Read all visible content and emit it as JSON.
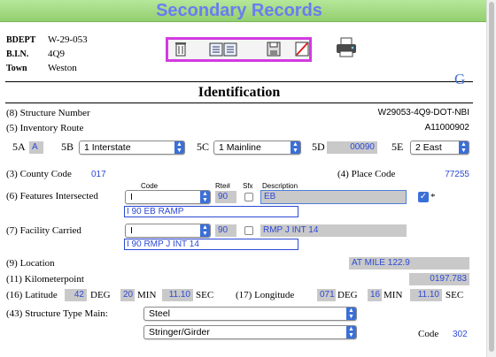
{
  "header": {
    "title": "Secondary Records"
  },
  "meta": {
    "bdept_label": "BDEPT",
    "bdept_value": "W-29-053",
    "bin_label": "B.I.N.",
    "bin_value": "4Q9",
    "town_label": "Town",
    "town_value": "Weston"
  },
  "section": {
    "title": "Identification",
    "corner_letter": "G"
  },
  "structure_number": {
    "label": "(8) Structure Number",
    "value": "W29053-4Q9-DOT-NBI"
  },
  "inventory_route": {
    "label": "(5) Inventory Route",
    "value": "A11000902",
    "f5a_label": "5A",
    "f5a_value": "A",
    "f5b_label": "5B",
    "f5b_value": "1 Interstate",
    "f5c_label": "5C",
    "f5c_value": "1 Mainline",
    "f5d_label": "5D",
    "f5d_value": "00090",
    "f5e_label": "5E",
    "f5e_value": "2 East"
  },
  "county_code": {
    "label": "(3) County Code",
    "value": "017"
  },
  "place_code": {
    "label": "(4) Place Code",
    "value": "77255"
  },
  "columns": {
    "code": "Code",
    "rte": "Rte#",
    "sfx": "Sfx",
    "desc": "Description"
  },
  "features_intersected": {
    "label": "(6) Features Intersected",
    "code": "I",
    "rte": "90",
    "desc": "EB",
    "star": "*",
    "full": "I 90 EB  RAMP"
  },
  "facility_carried": {
    "label": "(7) Facility Carried",
    "code": "I",
    "rte": "90",
    "desc": "RMP J INT 14",
    "full": "I  90 RMP J INT 14"
  },
  "location": {
    "label": "(9) Location",
    "value": "AT MILE 122.9"
  },
  "kilometerpoint": {
    "label": "(11) Kilometerpoint",
    "value": "0197.783"
  },
  "latitude": {
    "label": "(16) Latitude",
    "deg": "42",
    "deg_label": "DEG",
    "min": "20",
    "min_label": "MIN",
    "sec": "11.10",
    "sec_label": "SEC"
  },
  "longitude": {
    "label": "(17) Longitude",
    "deg": "071",
    "deg_label": "DEG",
    "min": "16",
    "min_label": "MIN",
    "sec": "11.10",
    "sec_label": "SEC"
  },
  "structure_type": {
    "label": "(43) Structure Type Main:",
    "material": "Steel",
    "design": "Stringer/Girder",
    "code_label": "Code",
    "code_value": "302"
  },
  "colors": {
    "header_bg": "#9fd87e",
    "header_text": "#6a7df0",
    "value_blue": "#2d49d6",
    "field_bg": "#c9c9c9",
    "toolbar_border": "#d23be0"
  },
  "icons": [
    "trash-icon",
    "records-icon",
    "save-icon",
    "cancel-icon",
    "printer-icon",
    "google-icon"
  ]
}
